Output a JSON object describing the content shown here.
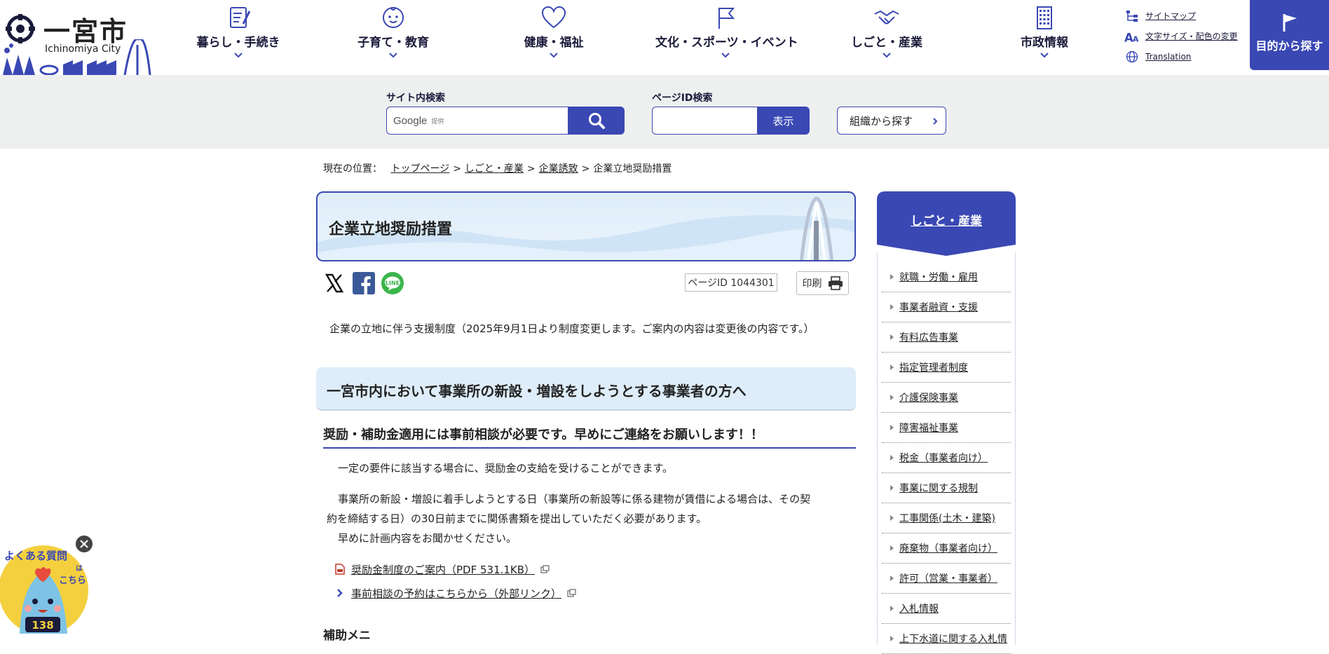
{
  "header": {
    "logo": {
      "title": "一宮市",
      "subtitle": "Ichinomiya City"
    },
    "nav": [
      {
        "label": "暮らし・手続き"
      },
      {
        "label": "子育て・教育"
      },
      {
        "label": "健康・福祉"
      },
      {
        "label": "文化・スポーツ・イベント"
      },
      {
        "label": "しごと・産業"
      },
      {
        "label": "市政情報"
      }
    ],
    "utility": [
      {
        "label": "サイトマップ",
        "icon": "sitemap-icon"
      },
      {
        "label": "文字サイズ・配色の変更",
        "icon": "text-size-icon"
      },
      {
        "label": "Translation",
        "icon": "globe-icon"
      }
    ],
    "purpose_button": "目的から探す"
  },
  "search": {
    "site_label": "サイト内検索",
    "google_text": "Google",
    "google_sub": "提供",
    "pageid_label": "ページID検索",
    "pageid_button": "表示",
    "org_button": "組織から探す"
  },
  "breadcrumb": {
    "prefix": "現在の位置：",
    "items": [
      "トップページ",
      "しごと・産業",
      "企業誘致",
      "企業立地奨励措置"
    ]
  },
  "main": {
    "title": "企業立地奨励措置",
    "page_id": "ページID 1044301",
    "print": "印刷",
    "intro": "企業の立地に伴う支援制度（2025年9月1日より制度変更します。ご案内の内容は変更後の内容です。）",
    "h2": "一宮市内において事業所の新設・増設をしようとする事業者の方へ",
    "h3": "奨励・補助金適用には事前相談が必要です。早めにご連絡をお願いします！！",
    "p1": "一定の要件に該当する場合に、奨励金の支給を受けることができます。",
    "p2a": "事業所の新設・増設に着手しようとする日（事業所の新設等に係る建物が賃借による場合は、その契",
    "p2b": "約を締結する日）の30日前までに関係書類を提出していただく必要があります。",
    "p3": "早めに計画内容をお聞かせください。",
    "links": [
      {
        "text": "奨励金制度のご案内（PDF 531.1KB）",
        "icon": "pdf-icon"
      },
      {
        "text": "事前相談の予約はこちらから（外部リンク）",
        "icon": "chevron-right-icon"
      }
    ],
    "next_heading": "補助メニ"
  },
  "sidebar": {
    "heading": "しごと・産業",
    "items": [
      {
        "label": "就職・労働・雇用"
      },
      {
        "label": "事業者融資・支援"
      },
      {
        "label": "有料広告事業"
      },
      {
        "label": "指定管理者制度"
      },
      {
        "label": "介護保険事業"
      },
      {
        "label": "障害福祉事業"
      },
      {
        "label": "税金（事業者向け）"
      },
      {
        "label": "事業に関する規制"
      },
      {
        "label": "工事関係(土木・建築)"
      },
      {
        "label": "廃棄物（事業者向け）"
      },
      {
        "label": "許可（営業・事業者）"
      },
      {
        "label": "入札情報"
      },
      {
        "label": "上下水道に関する入札情"
      }
    ]
  },
  "faq": {
    "line1": "よくある質問",
    "line2": "は",
    "line3": "こちら",
    "number": "138"
  },
  "colors": {
    "brand": "#3a48b4",
    "band": "#eef0f0",
    "title_bg": "#dfeefa"
  }
}
